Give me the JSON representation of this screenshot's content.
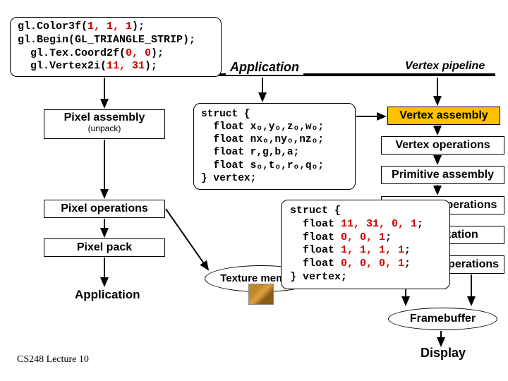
{
  "code_top": {
    "l1a": "gl.Color3f(",
    "l1b": "1, 1, 1",
    "l1c": ");",
    "l2": "gl.Begin(GL_TRIANGLE_STRIP);",
    "l3a": "  gl.Tex.Coord2f(",
    "l3b": "0, 0",
    "l3c": ");",
    "l4a": "  gl.Vertex2i(",
    "l4b": "11, 31",
    "l4c": ");"
  },
  "top": {
    "application": "Application",
    "vertex_pipeline": "Vertex pipeline"
  },
  "struct_mid": "struct {\n  float xₒ,yₒ,zₒ,wₒ;\n  float nxₒ,nyₒ,nzₒ;\n  float r,g,b,a;\n  float sₒ,tₒ,rₒ,qₒ;\n} vertex;",
  "struct_right": {
    "l1": "struct {",
    "l2a": "  float ",
    "l2b": "11, 31, 0, 1",
    "l2c": ";",
    "l3a": "  float ",
    "l3b": "0, 0, 1",
    "l3c": ";",
    "l4a": "  float ",
    "l4b": "1, 1, 1, 1",
    "l4c": ";",
    "l5a": "  float ",
    "l5b": "0, 0, 0, 1",
    "l5c": ";",
    "l6": "} vertex;"
  },
  "left": {
    "pixel_assembly": "Pixel assembly",
    "unpack": "(unpack)",
    "pixel_ops": "Pixel operations",
    "pixel_pack": "Pixel pack",
    "application": "Application"
  },
  "right": {
    "vertex_assembly": "Vertex assembly",
    "vertex_ops": "Vertex operations",
    "primitive_assembly": "Primitive assembly",
    "primitive_ops": "Primitive operations",
    "rasterization": "Rasterization",
    "fragment_ops": "Fragment operations",
    "texture_mem": "Texture memory",
    "framebuffer": "Framebuffer",
    "display": "Display"
  },
  "footer": "CS248 Lecture 10"
}
